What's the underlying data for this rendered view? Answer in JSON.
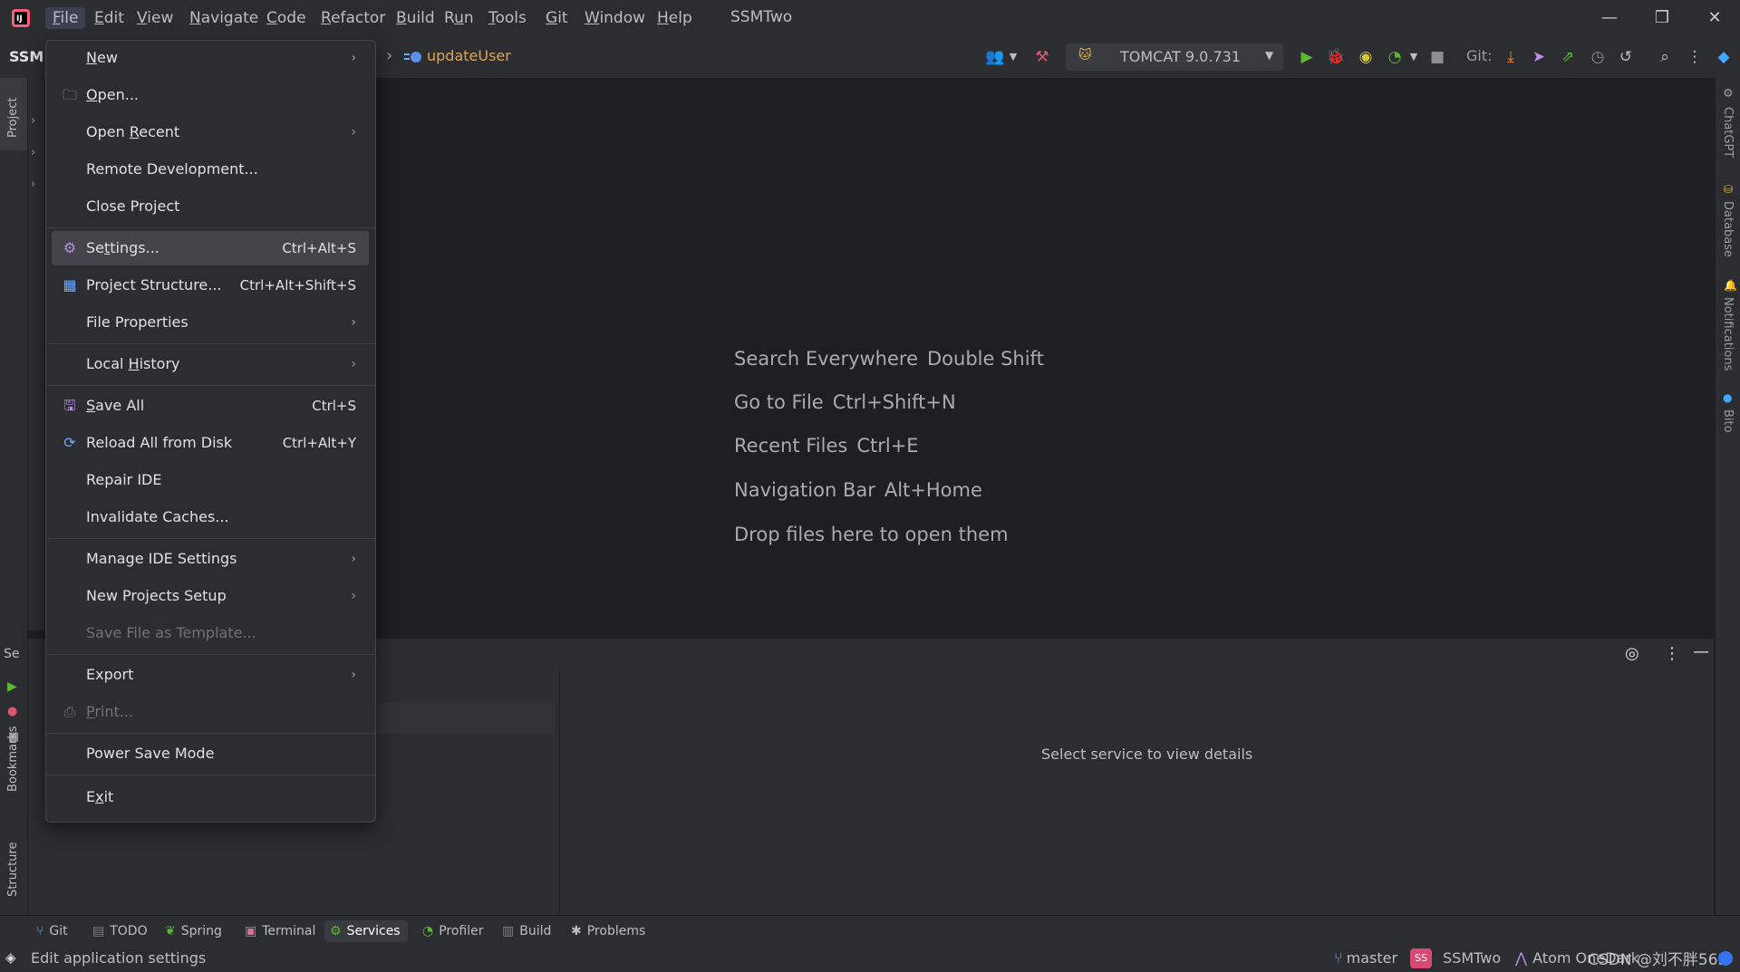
{
  "window": {
    "project_name": "SSMTwo",
    "menus": [
      {
        "pre": "",
        "mn": "F",
        "post": "ile"
      },
      {
        "pre": "",
        "mn": "E",
        "post": "dit"
      },
      {
        "pre": "",
        "mn": "V",
        "post": "iew"
      },
      {
        "pre": "",
        "mn": "N",
        "post": "avigate"
      },
      {
        "pre": "",
        "mn": "C",
        "post": "ode"
      },
      {
        "pre": "",
        "mn": "R",
        "post": "efactor"
      },
      {
        "pre": "",
        "mn": "B",
        "post": "uild"
      },
      {
        "pre": "R",
        "mn": "u",
        "post": "n"
      },
      {
        "pre": "",
        "mn": "T",
        "post": "ools"
      },
      {
        "pre": "",
        "mn": "G",
        "post": "it"
      },
      {
        "pre": "",
        "mn": "W",
        "post": "indow"
      },
      {
        "pre": "",
        "mn": "H",
        "post": "elp"
      }
    ],
    "minimize": "—",
    "restore": "❐",
    "close": "✕"
  },
  "toolbar": {
    "project_label": "SSM1",
    "breadcrumb_sep": "›",
    "method_name": "updateUser",
    "run_config": "TOMCAT 9.0.731",
    "git_label": "Git:"
  },
  "file_menu": {
    "new": {
      "pre": "",
      "mn": "N",
      "post": "ew"
    },
    "open": {
      "pre": "",
      "mn": "O",
      "post": "pen..."
    },
    "open_recent": {
      "pre": "Open ",
      "mn": "R",
      "post": "ecent"
    },
    "remote_dev": "Remote Development...",
    "close_project": "Close Project",
    "settings": {
      "pre": "Se",
      "mn": "t",
      "post": "tings..."
    },
    "settings_shortcut": "Ctrl+Alt+S",
    "project_structure": "Project Structure...",
    "project_structure_shortcut": "Ctrl+Alt+Shift+S",
    "file_properties": "File Properties",
    "local_history": {
      "pre": "Local ",
      "mn": "H",
      "post": "istory"
    },
    "save_all": {
      "pre": "",
      "mn": "S",
      "post": "ave All"
    },
    "save_all_shortcut": "Ctrl+S",
    "reload_all": "Reload All from Disk",
    "reload_all_shortcut": "Ctrl+Alt+Y",
    "repair_ide": "Repair IDE",
    "invalidate_caches": "Invalidate Caches...",
    "manage_ide_settings": "Manage IDE Settings",
    "new_projects_setup": "New Projects Setup",
    "save_as_template": "Save File as Template...",
    "export": "Export",
    "print": {
      "pre": "",
      "mn": "P",
      "post": "rint..."
    },
    "power_save": "Power Save Mode",
    "exit": {
      "pre": "E",
      "mn": "x",
      "post": "it"
    }
  },
  "editor_hints": [
    {
      "action": "Search Everywhere",
      "key": "Double Shift"
    },
    {
      "action": "Go to File",
      "key": "Ctrl+Shift+N"
    },
    {
      "action": "Recent Files",
      "key": "Ctrl+E"
    },
    {
      "action": "Navigation Bar",
      "key": "Alt+Home"
    },
    {
      "action": "Drop files here to open them",
      "key": ""
    }
  ],
  "left_stripe": {
    "project": "Project",
    "bookmarks": "Bookmarks",
    "structure": "Structure",
    "services_short": "Se"
  },
  "right_stripe": {
    "chatgpt": "ChatGPT",
    "database": "Database",
    "notifications": "Notifications",
    "bito": "Bito"
  },
  "services": {
    "detail_placeholder": "Select service to view details"
  },
  "bottom_tools": [
    "Git",
    "TODO",
    "Spring",
    "Terminal",
    "Services",
    "Profiler",
    "Build",
    "Problems"
  ],
  "status": {
    "message": "Edit application settings",
    "branch": "master",
    "project_badge": "SS",
    "project": "SSMTwo",
    "plugin": "Atom OneDark",
    "watermark": "CSDN @刘不胖563"
  },
  "colors": {
    "accent": "#3574f0",
    "run_green": "#5fb832",
    "debug_red": "#e0556a",
    "git_orange": "#e8833a"
  }
}
